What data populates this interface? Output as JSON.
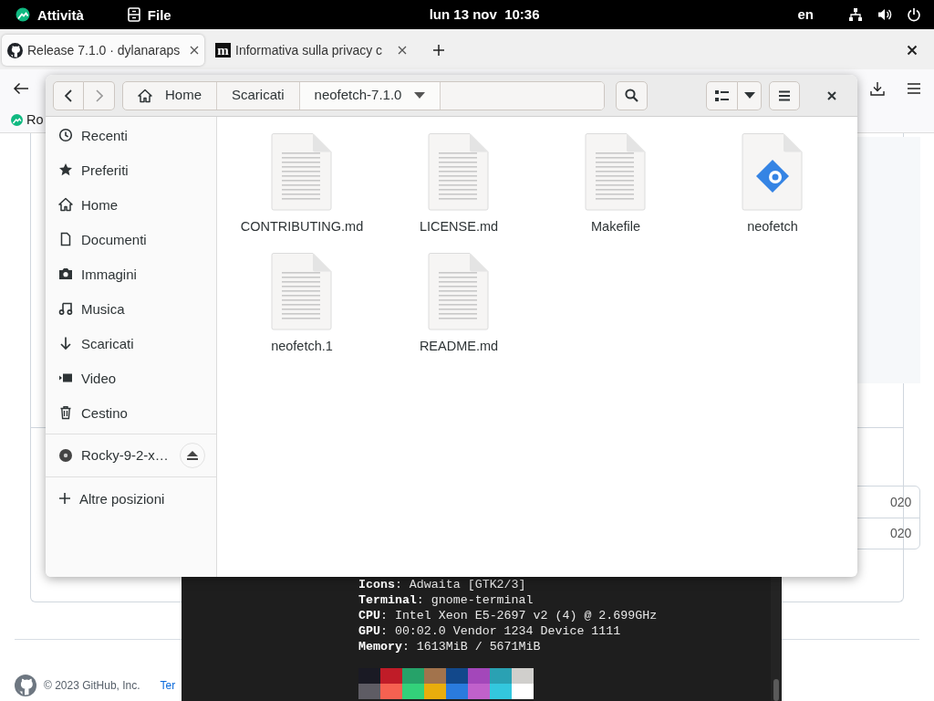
{
  "top_bar": {
    "activities": "Attività",
    "app_menu": "File",
    "clock": "lun 13 nov  10:36",
    "input_source": "en"
  },
  "browser": {
    "tabs": [
      {
        "title": "Release 7.1.0 · dylanaraps",
        "selected": true,
        "kind": "github"
      },
      {
        "title": "Informativa sulla privacy c",
        "selected": false,
        "kind": "letter",
        "favicon_letter": "m"
      }
    ],
    "bookmarks": [
      {
        "label": "Ro"
      }
    ],
    "page": {
      "table_cells": [
        "020",
        "020"
      ],
      "footer_copyright": "© 2023 GitHub, Inc.",
      "footer_link": "Ter"
    }
  },
  "file_manager": {
    "path": [
      {
        "label": "Home",
        "kind": "home",
        "current": false
      },
      {
        "label": "Scaricati",
        "kind": "folder",
        "current": false
      },
      {
        "label": "neofetch-7.1.0",
        "kind": "folder",
        "current": true
      }
    ],
    "places": [
      {
        "label": "Recenti",
        "kind": "recent"
      },
      {
        "label": "Preferiti",
        "kind": "starred"
      },
      {
        "label": "Home",
        "kind": "home"
      },
      {
        "label": "Documenti",
        "kind": "documents"
      },
      {
        "label": "Immagini",
        "kind": "pictures"
      },
      {
        "label": "Musica",
        "kind": "music"
      },
      {
        "label": "Scaricati",
        "kind": "downloads"
      },
      {
        "label": "Video",
        "kind": "videos"
      },
      {
        "label": "Cestino",
        "kind": "trash"
      }
    ],
    "devices": [
      {
        "label": "Rocky-9-2-x…"
      }
    ],
    "other_locations": "Altre posizioni",
    "files": [
      {
        "name": "CONTRIBUTING.md",
        "kind": "text"
      },
      {
        "name": "LICENSE.md",
        "kind": "text"
      },
      {
        "name": "Makefile",
        "kind": "text"
      },
      {
        "name": "neofetch",
        "kind": "script"
      },
      {
        "name": "neofetch.1",
        "kind": "text"
      },
      {
        "name": "README.md",
        "kind": "text"
      }
    ]
  },
  "terminal": {
    "lines": [
      "**Icons**: Adwaita [GTK2/3]",
      "**Terminal**: gnome-terminal",
      "**CPU**: Intel Xeon E5-2697 v2 (4) @ 2.699GHz",
      "**GPU**: 00:02.0 Vendor 1234 Device 1111",
      "**Memory**: 1613MiB / 5671MiB"
    ],
    "palette": [
      {
        "swatches": [
          {
            "color": "#1a1a24"
          },
          {
            "color": "#c01c28"
          },
          {
            "color": "#26a269"
          },
          {
            "color": "#a2734c"
          },
          {
            "color": "#12488b"
          },
          {
            "color": "#a347ba"
          },
          {
            "color": "#2aa1b3"
          },
          {
            "color": "#d0cfcc"
          }
        ]
      },
      {
        "swatches": [
          {
            "color": "#5e5c64"
          },
          {
            "color": "#f66151"
          },
          {
            "color": "#33d17a"
          },
          {
            "color": "#e9ad0c"
          },
          {
            "color": "#2a7bde"
          },
          {
            "color": "#c061cb"
          },
          {
            "color": "#33c7de"
          },
          {
            "color": "#ffffff"
          }
        ]
      }
    ]
  }
}
